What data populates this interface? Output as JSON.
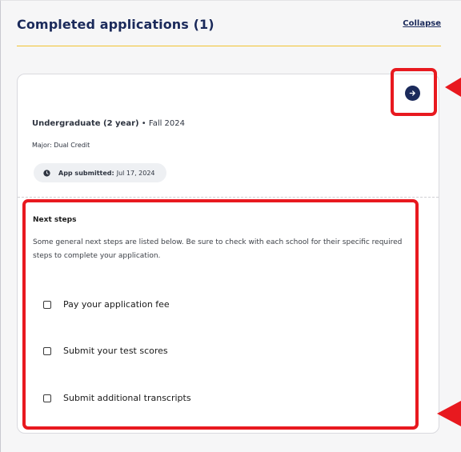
{
  "section": {
    "title": "Completed applications (1)",
    "collapse_label": "Collapse"
  },
  "application": {
    "program": "Undergraduate (2 year)",
    "separator": " • ",
    "term": "Fall 2024",
    "major": "Major: Dual Credit",
    "submitted_label": "App submitted:",
    "submitted_date": "Jul 17, 2024",
    "open_icon": "arrow-right-icon",
    "submitted_icon": "clock-icon"
  },
  "next_steps": {
    "title": "Next steps",
    "description": "Some general next steps are listed below. Be sure to check with each school for their specific required steps to complete your application.",
    "items": [
      {
        "label": "Pay your application fee",
        "checked": false
      },
      {
        "label": "Submit your test scores",
        "checked": false
      },
      {
        "label": "Submit additional transcripts",
        "checked": false
      }
    ]
  },
  "colors": {
    "brand_navy": "#1b2a5b",
    "accent_gold": "#f2c230",
    "annotation_red": "#e8191f"
  }
}
